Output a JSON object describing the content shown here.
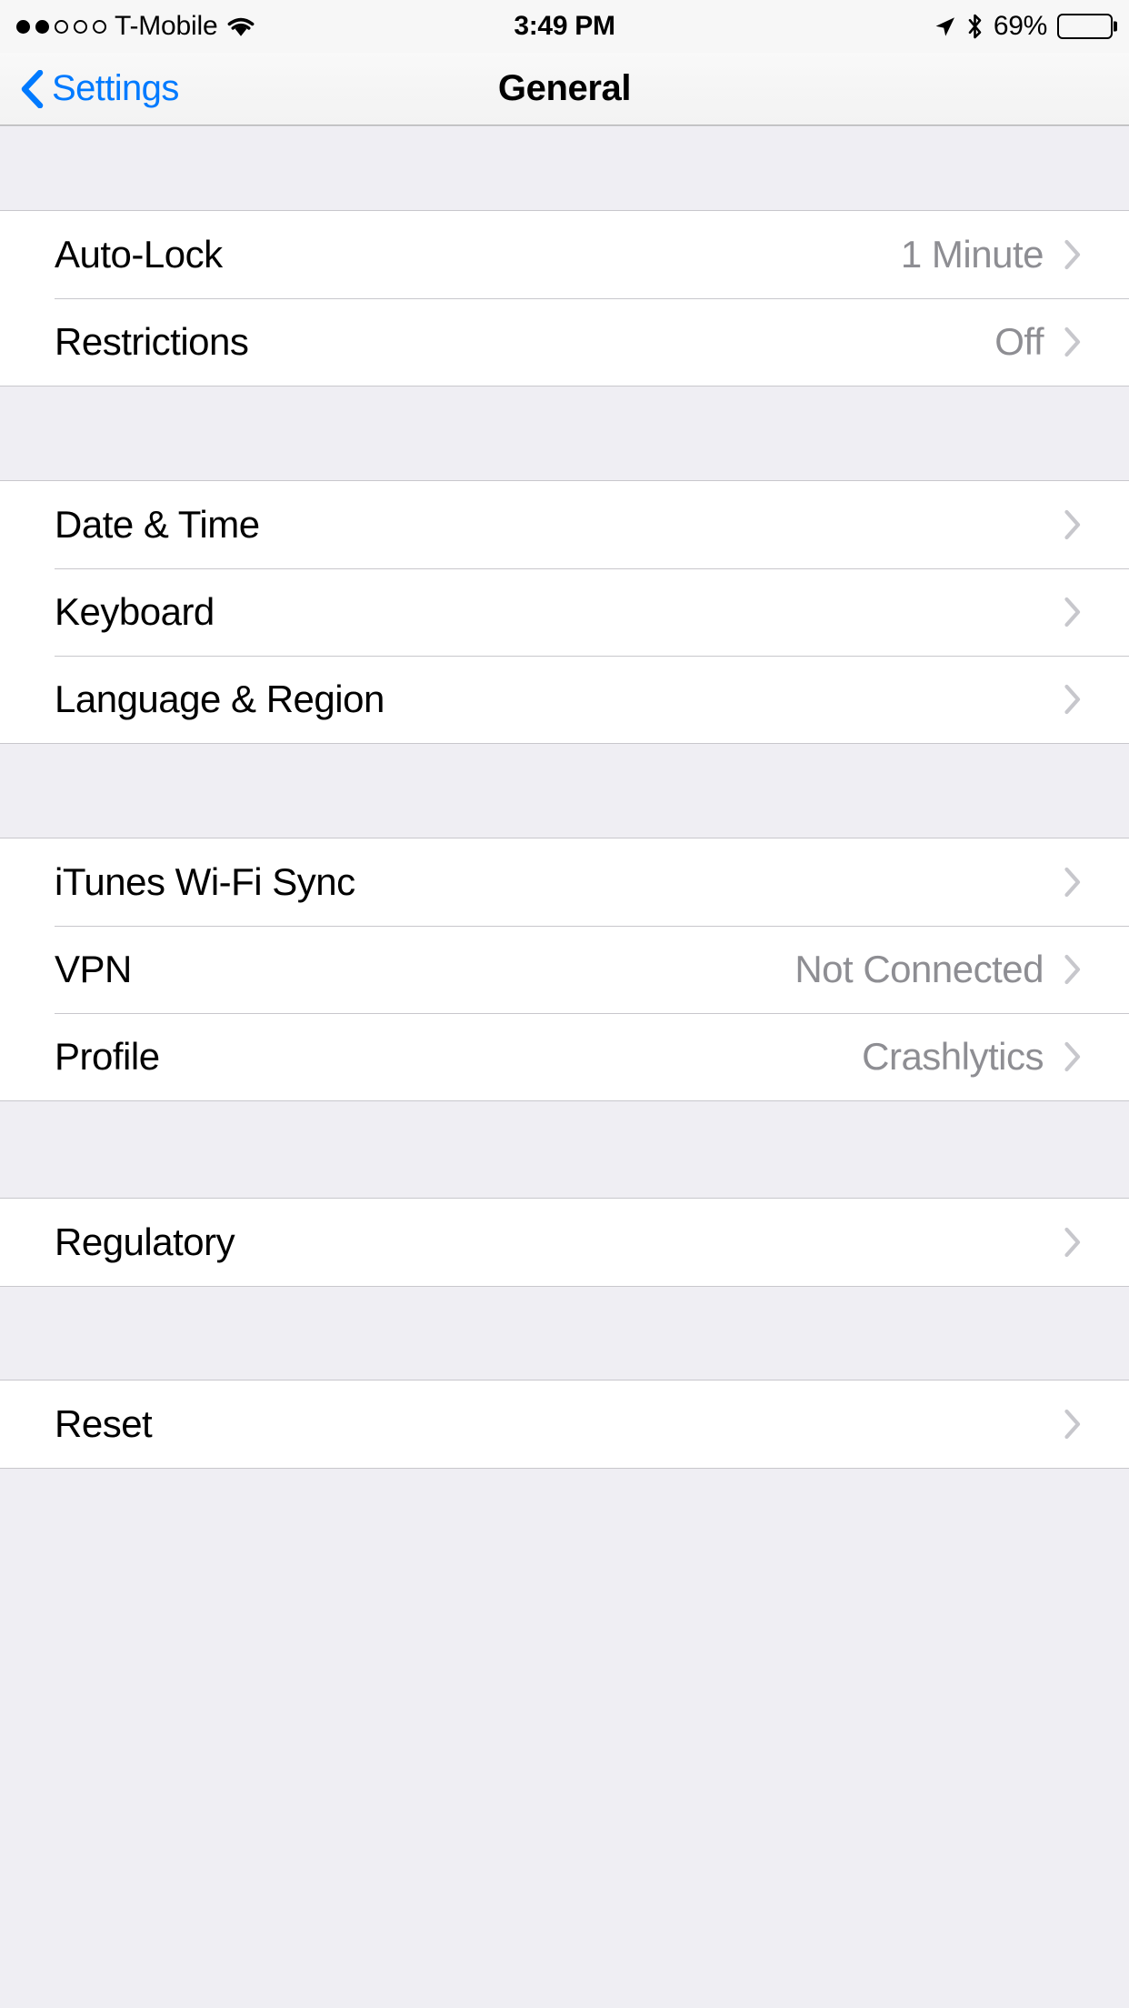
{
  "status_bar": {
    "signal_dots_total": 5,
    "signal_dots_filled": 2,
    "carrier": "T-Mobile",
    "wifi_icon": "wifi-icon",
    "time": "3:49 PM",
    "location_icon": "location-arrow-icon",
    "bluetooth_icon": "bluetooth-icon",
    "battery_percent": "69%",
    "battery_level": 69
  },
  "nav": {
    "back_icon": "chevron-left-icon",
    "back_label": "Settings",
    "title": "General"
  },
  "colors": {
    "accent": "#007AFF",
    "value_text": "#8E8E93",
    "chevron": "#C7C7CC",
    "group_bg": "#FFFFFF",
    "spacer_bg": "#EFEEF3",
    "separator": "#C8C7CC"
  },
  "groups": [
    {
      "spacer_height": 94,
      "rows": [
        {
          "label": "Auto-Lock",
          "value": "1 Minute",
          "chevron": "chevron-right-icon"
        },
        {
          "label": "Restrictions",
          "value": "Off",
          "chevron": "chevron-right-icon"
        }
      ]
    },
    {
      "spacer_height": 105,
      "rows": [
        {
          "label": "Date & Time",
          "value": "",
          "chevron": "chevron-right-icon"
        },
        {
          "label": "Keyboard",
          "value": "",
          "chevron": "chevron-right-icon"
        },
        {
          "label": "Language & Region",
          "value": "",
          "chevron": "chevron-right-icon"
        }
      ]
    },
    {
      "spacer_height": 105,
      "rows": [
        {
          "label": "iTunes Wi-Fi Sync",
          "value": "",
          "chevron": "chevron-right-icon"
        },
        {
          "label": "VPN",
          "value": "Not Connected",
          "chevron": "chevron-right-icon"
        },
        {
          "label": "Profile",
          "value": "Crashlytics",
          "chevron": "chevron-right-icon"
        }
      ]
    },
    {
      "spacer_height": 108,
      "rows": [
        {
          "label": "Regulatory",
          "value": "",
          "chevron": "chevron-right-icon"
        }
      ]
    },
    {
      "spacer_height": 104,
      "rows": [
        {
          "label": "Reset",
          "value": "",
          "chevron": "chevron-right-icon"
        }
      ]
    }
  ],
  "tail_spacer_height": 113
}
